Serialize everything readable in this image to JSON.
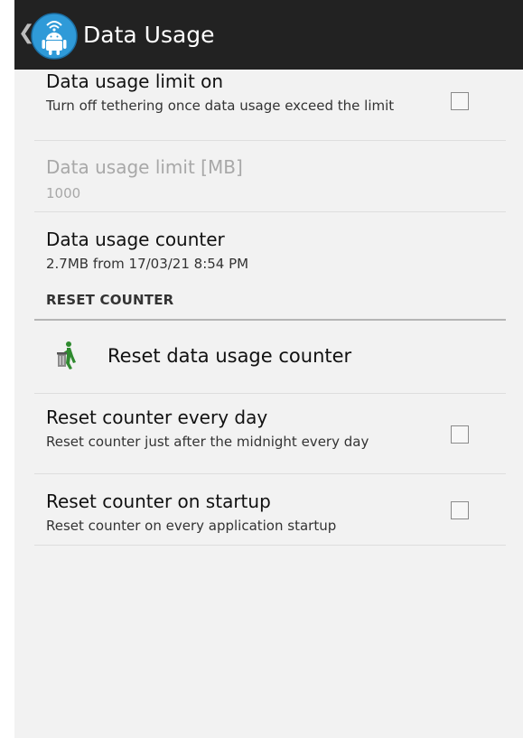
{
  "action_bar": {
    "title": "Data Usage",
    "up_icon": "chevron-left-icon",
    "app_icon": "android-wifi-icon"
  },
  "preferences": {
    "limit_on": {
      "title": "Data usage limit on",
      "summary": "Turn off tethering once data usage exceed the limit",
      "checked": false
    },
    "limit_mb": {
      "title": "Data usage limit [MB]",
      "summary": "1000",
      "enabled": false
    },
    "counter": {
      "title": "Data usage counter",
      "summary": "2.7MB from 17/03/21 8:54 PM"
    },
    "category_reset": "RESET COUNTER",
    "reset_button": {
      "title": "Reset data usage counter",
      "icon": "trash-person-icon"
    },
    "reset_daily": {
      "title": "Reset counter every day",
      "summary": "Reset counter just after the midnight every day",
      "checked": false
    },
    "reset_startup": {
      "title": "Reset counter on startup",
      "summary": "Reset counter on every application startup",
      "checked": false
    }
  },
  "colors": {
    "action_bar_bg": "#222222",
    "list_bg": "#f2f2f2",
    "icon_blue": "#2f9ad8",
    "icon_green": "#2f8a2f"
  }
}
